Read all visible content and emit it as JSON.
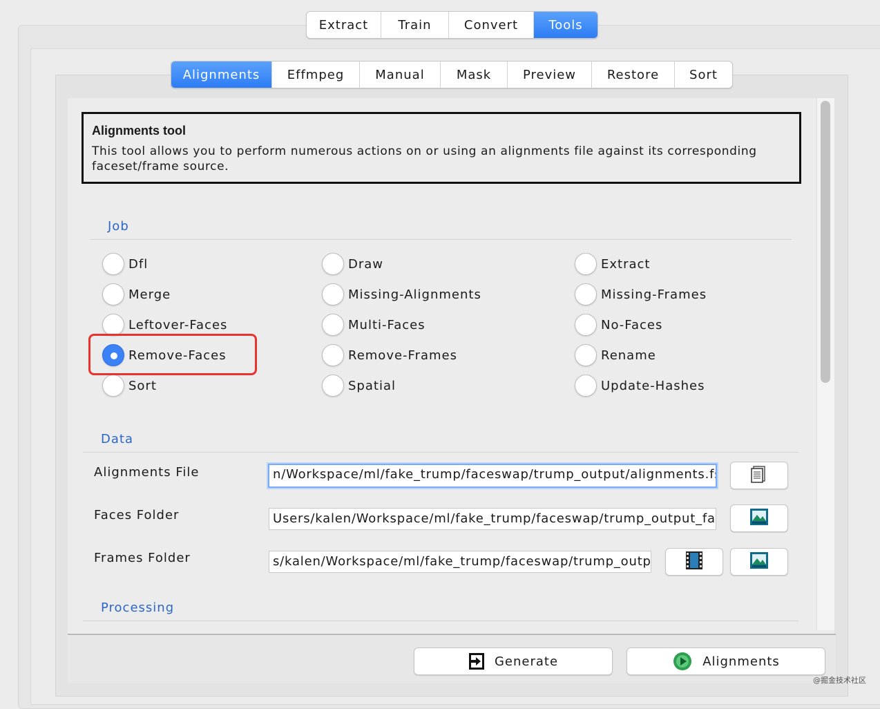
{
  "main_tabs": [
    {
      "label": "Extract",
      "active": false
    },
    {
      "label": "Train",
      "active": false
    },
    {
      "label": "Convert",
      "active": false
    },
    {
      "label": "Tools",
      "active": true
    }
  ],
  "tool_tabs": [
    {
      "label": "Alignments",
      "active": true
    },
    {
      "label": "Effmpeg",
      "active": false
    },
    {
      "label": "Manual",
      "active": false
    },
    {
      "label": "Mask",
      "active": false
    },
    {
      "label": "Preview",
      "active": false
    },
    {
      "label": "Restore",
      "active": false
    },
    {
      "label": "Sort",
      "active": false
    }
  ],
  "info": {
    "title": "Alignments tool",
    "text": "This tool allows you to perform numerous actions on or using an alignments file against its corresponding faceset/frame source."
  },
  "job": {
    "title": "Job",
    "options": [
      [
        "Dfl",
        "Draw",
        "Extract"
      ],
      [
        "Merge",
        "Missing-Alignments",
        "Missing-Frames"
      ],
      [
        "Leftover-Faces",
        "Multi-Faces",
        "No-Faces"
      ],
      [
        "Remove-Faces",
        "Remove-Frames",
        "Rename"
      ],
      [
        "Sort",
        "Spatial",
        "Update-Hashes"
      ]
    ],
    "selected": "Remove-Faces"
  },
  "data": {
    "title": "Data",
    "alignments_file": {
      "label": "Alignments File",
      "value": "n/Workspace/ml/fake_trump/faceswap/trump_output/alignments.fsa\"",
      "button_icon": "file-icon"
    },
    "faces_folder": {
      "label": "Faces Folder",
      "value": "Users/kalen/Workspace/ml/fake_trump/faceswap/trump_output_face",
      "button_icon": "image-folder-icon"
    },
    "frames_folder": {
      "label": "Frames Folder",
      "value": "s/kalen/Workspace/ml/fake_trump/faceswap/trump_output",
      "button_icons": [
        "video-icon",
        "image-folder-icon"
      ]
    }
  },
  "processing": {
    "title": "Processing"
  },
  "actions": {
    "generate_label": "Generate",
    "generate_icon": "generate-icon",
    "run_label": "Alignments",
    "run_icon": "play-icon"
  },
  "colors": {
    "accent": "#2d7cf5",
    "section_title": "#2c66c8",
    "highlight": "#e8322d",
    "run_icon": "#2e9e4f"
  },
  "watermark": "@掘金技术社区"
}
